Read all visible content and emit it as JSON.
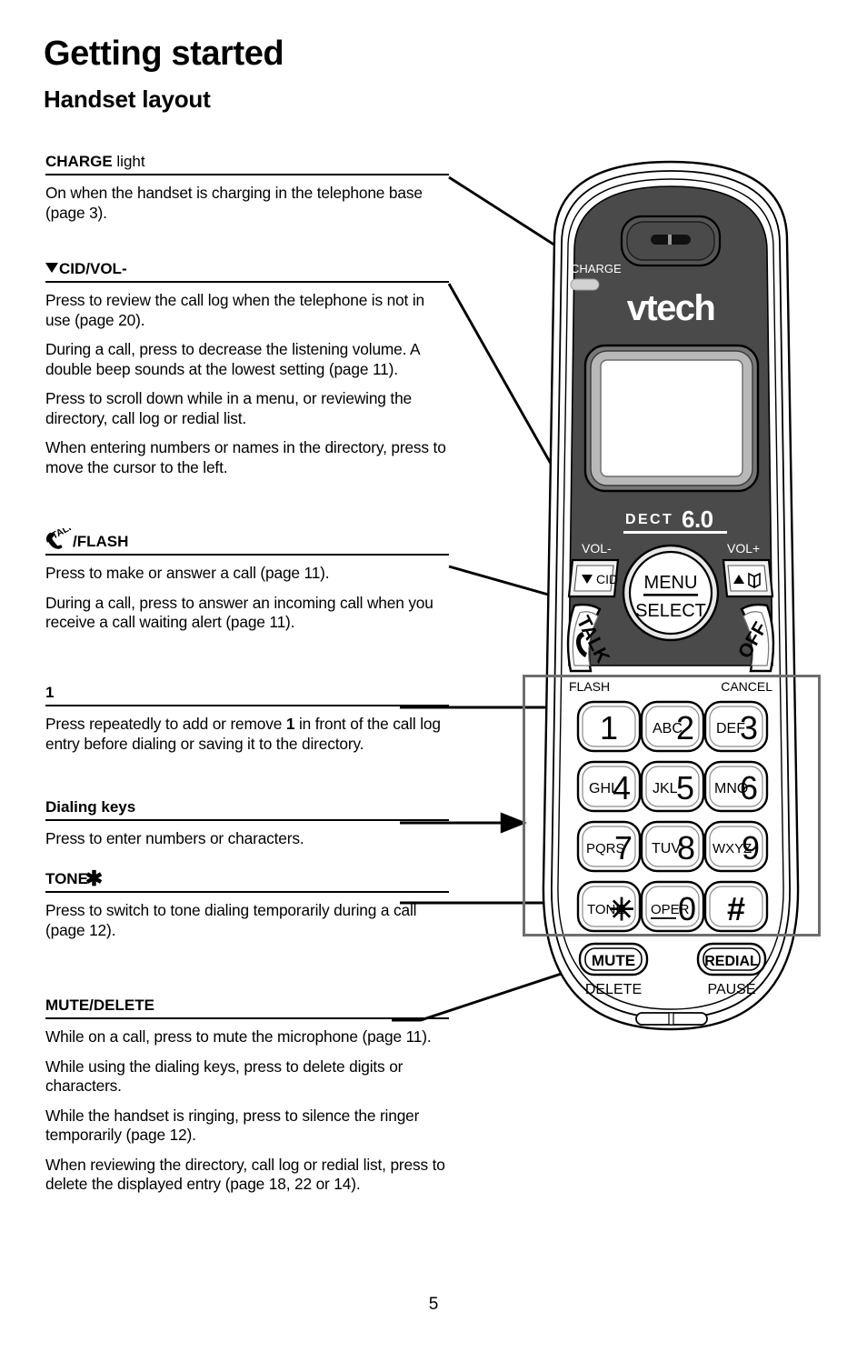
{
  "page": {
    "title": "Getting started",
    "section": "Handset layout",
    "number": "5"
  },
  "callouts": [
    {
      "id": "charge-light",
      "heading_bold": "CHARGE",
      "heading_rest": " light",
      "paragraphs": [
        "On when the handset is charging in the telephone base (page 3)."
      ]
    },
    {
      "id": "cid-vol-down",
      "heading_icon": "triangle-down-icon",
      "heading_bold": "CID/VOL-",
      "paragraphs": [
        "Press to review the call log when the telephone is not in use (page 20).",
        "During a call, press to decrease the listening volume. A double beep sounds at the lowest setting (page 11).",
        "Press to scroll down while in a menu, or reviewing the directory, call log or redial list.",
        "When entering numbers or names in the directory, press to move the cursor to the left."
      ]
    },
    {
      "id": "talk-flash",
      "heading_icon": "talk-handset-icon",
      "heading_bold": "/FLASH",
      "paragraphs": [
        "Press to make or answer a call (page 11).",
        "During a call, press to answer an incoming call when you receive a call waiting alert (page 11)."
      ]
    },
    {
      "id": "key-one",
      "heading_bold": "1",
      "paragraphs": [
        "Press repeatedly to add or remove 1 in front of the call log entry before dialing or saving it to the directory."
      ]
    },
    {
      "id": "dialing-keys",
      "heading_bold": "Dialing keys",
      "paragraphs": [
        "Press to enter numbers or characters."
      ]
    },
    {
      "id": "tone-star",
      "heading_bold": "TONE",
      "heading_icon_after": "star-icon",
      "paragraphs": [
        "Press to switch to tone dialing temporarily during a call (page 12)."
      ]
    },
    {
      "id": "mute-delete",
      "heading_bold": "MUTE/DELETE",
      "paragraphs": [
        "While on a call, press to mute the microphone (page 11).",
        "While using the dialing keys, press to delete digits or characters.",
        "While the handset is ringing, press to silence the ringer temporarily (page 12).",
        "When reviewing the directory, call log or redial list, press to delete the displayed entry (page 18, 22 or 14)."
      ]
    }
  ],
  "handset": {
    "charge_label": "CHARGE",
    "brand": "vtech",
    "dect_prefix": "DECT",
    "dect_version": "6.0",
    "vol_down_label": "VOL-",
    "vol_up_label": "VOL+",
    "cid_button": "CID",
    "menu_line1": "MENU",
    "menu_line2": "SELECT",
    "talk_button": "TALK",
    "off_button": "OFF",
    "flash_label": "FLASH",
    "cancel_label": "CANCEL",
    "mute_button": "MUTE",
    "delete_label": "DELETE",
    "redial_button": "REDIAL",
    "pause_label": "PAUSE",
    "keys": [
      {
        "letters": "",
        "digit": "1"
      },
      {
        "letters": "ABC",
        "digit": "2"
      },
      {
        "letters": "DEF",
        "digit": "3"
      },
      {
        "letters": "GHI",
        "digit": "4"
      },
      {
        "letters": "JKL",
        "digit": "5"
      },
      {
        "letters": "MNO",
        "digit": "6"
      },
      {
        "letters": "PQRS",
        "digit": "7"
      },
      {
        "letters": "TUV",
        "digit": "8"
      },
      {
        "letters": "WXYZ",
        "digit": "9"
      },
      {
        "letters": "TONE",
        "digit": "✳"
      },
      {
        "letters": "OPER",
        "digit": "0"
      },
      {
        "letters": "",
        "digit": "#"
      }
    ],
    "colors": {
      "body_dark": "#4a4a4a",
      "body_light": "#ffffff",
      "screen": "#ffffff",
      "screen_bezel": "#b8b8b8",
      "outline": "#000000"
    }
  }
}
